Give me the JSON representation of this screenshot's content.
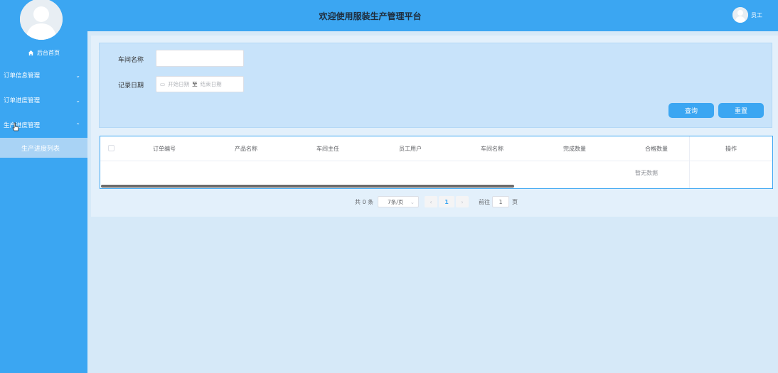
{
  "header": {
    "title": "欢迎使用服装生产管理平台",
    "user_label": "员工"
  },
  "sidebar": {
    "home_label": "后台首页",
    "items": [
      {
        "label": "订单信息管理",
        "chevron": "chevron-down"
      },
      {
        "label": "订单进度管理",
        "chevron": "chevron-down"
      },
      {
        "label": "生产进度管理",
        "chevron": "chevron-up"
      }
    ],
    "active_sub_item": "生产进度列表"
  },
  "search": {
    "workshop_label": "车间名称",
    "workshop_value": "",
    "date_label": "记录日期",
    "start_placeholder": "开始日期",
    "range_separator": "至",
    "end_placeholder": "结束日期",
    "query_button": "查询",
    "reset_button": "重置"
  },
  "table": {
    "columns": [
      "订单编号",
      "产品名称",
      "车间主任",
      "员工用户",
      "车间名称",
      "完成数量",
      "合格数量",
      "操作"
    ],
    "rows": [],
    "empty_text": "暂无数据"
  },
  "pagination": {
    "total_text": "共 0 条",
    "page_size": "7条/页",
    "current_page": "1",
    "goto_label": "前往",
    "goto_value": "1",
    "page_unit": "页"
  },
  "colors": {
    "primary": "#3ba6f2",
    "panel": "#c8e3fa",
    "active_sub": "#a9d3f5"
  }
}
